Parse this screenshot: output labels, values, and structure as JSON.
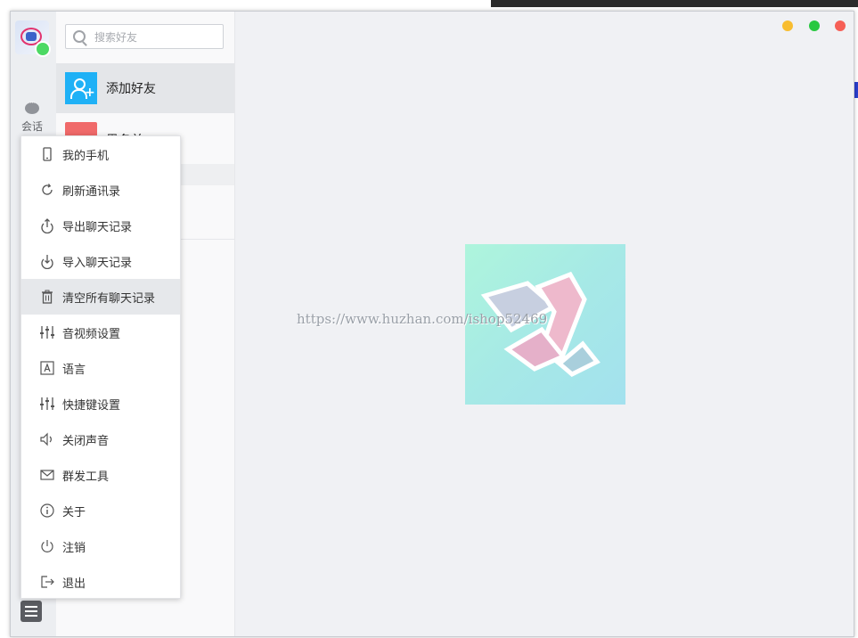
{
  "search": {
    "placeholder": "搜索好友"
  },
  "sidebar": {
    "nav_session_label": "会话"
  },
  "contacts": {
    "add_friend_label": "添加好友",
    "second_item_label": "黑名单"
  },
  "watermark": "https://www.huzhan.com/ishop52469",
  "window_controls": {
    "min_color": "#f8bd30",
    "max_color": "#29c840",
    "close_color": "#f65f56"
  },
  "colors": {
    "accent": "#1fb1f6",
    "online": "#4cd964"
  },
  "menu": {
    "items": [
      {
        "label": "我的手机",
        "icon": "phone-icon"
      },
      {
        "label": "刷新通讯录",
        "icon": "refresh-icon"
      },
      {
        "label": "导出聊天记录",
        "icon": "export-icon"
      },
      {
        "label": "导入聊天记录",
        "icon": "import-icon"
      },
      {
        "label": "清空所有聊天记录",
        "icon": "trash-icon",
        "highlighted": true
      },
      {
        "label": "音视频设置",
        "icon": "sliders-icon"
      },
      {
        "label": "语言",
        "icon": "language-icon"
      },
      {
        "label": "快捷键设置",
        "icon": "sliders-icon"
      },
      {
        "label": "关闭声音",
        "icon": "speaker-icon"
      },
      {
        "label": "群发工具",
        "icon": "mail-icon"
      },
      {
        "label": "关于",
        "icon": "info-icon"
      },
      {
        "label": "注销",
        "icon": "power-icon"
      },
      {
        "label": "退出",
        "icon": "logout-icon"
      }
    ]
  }
}
